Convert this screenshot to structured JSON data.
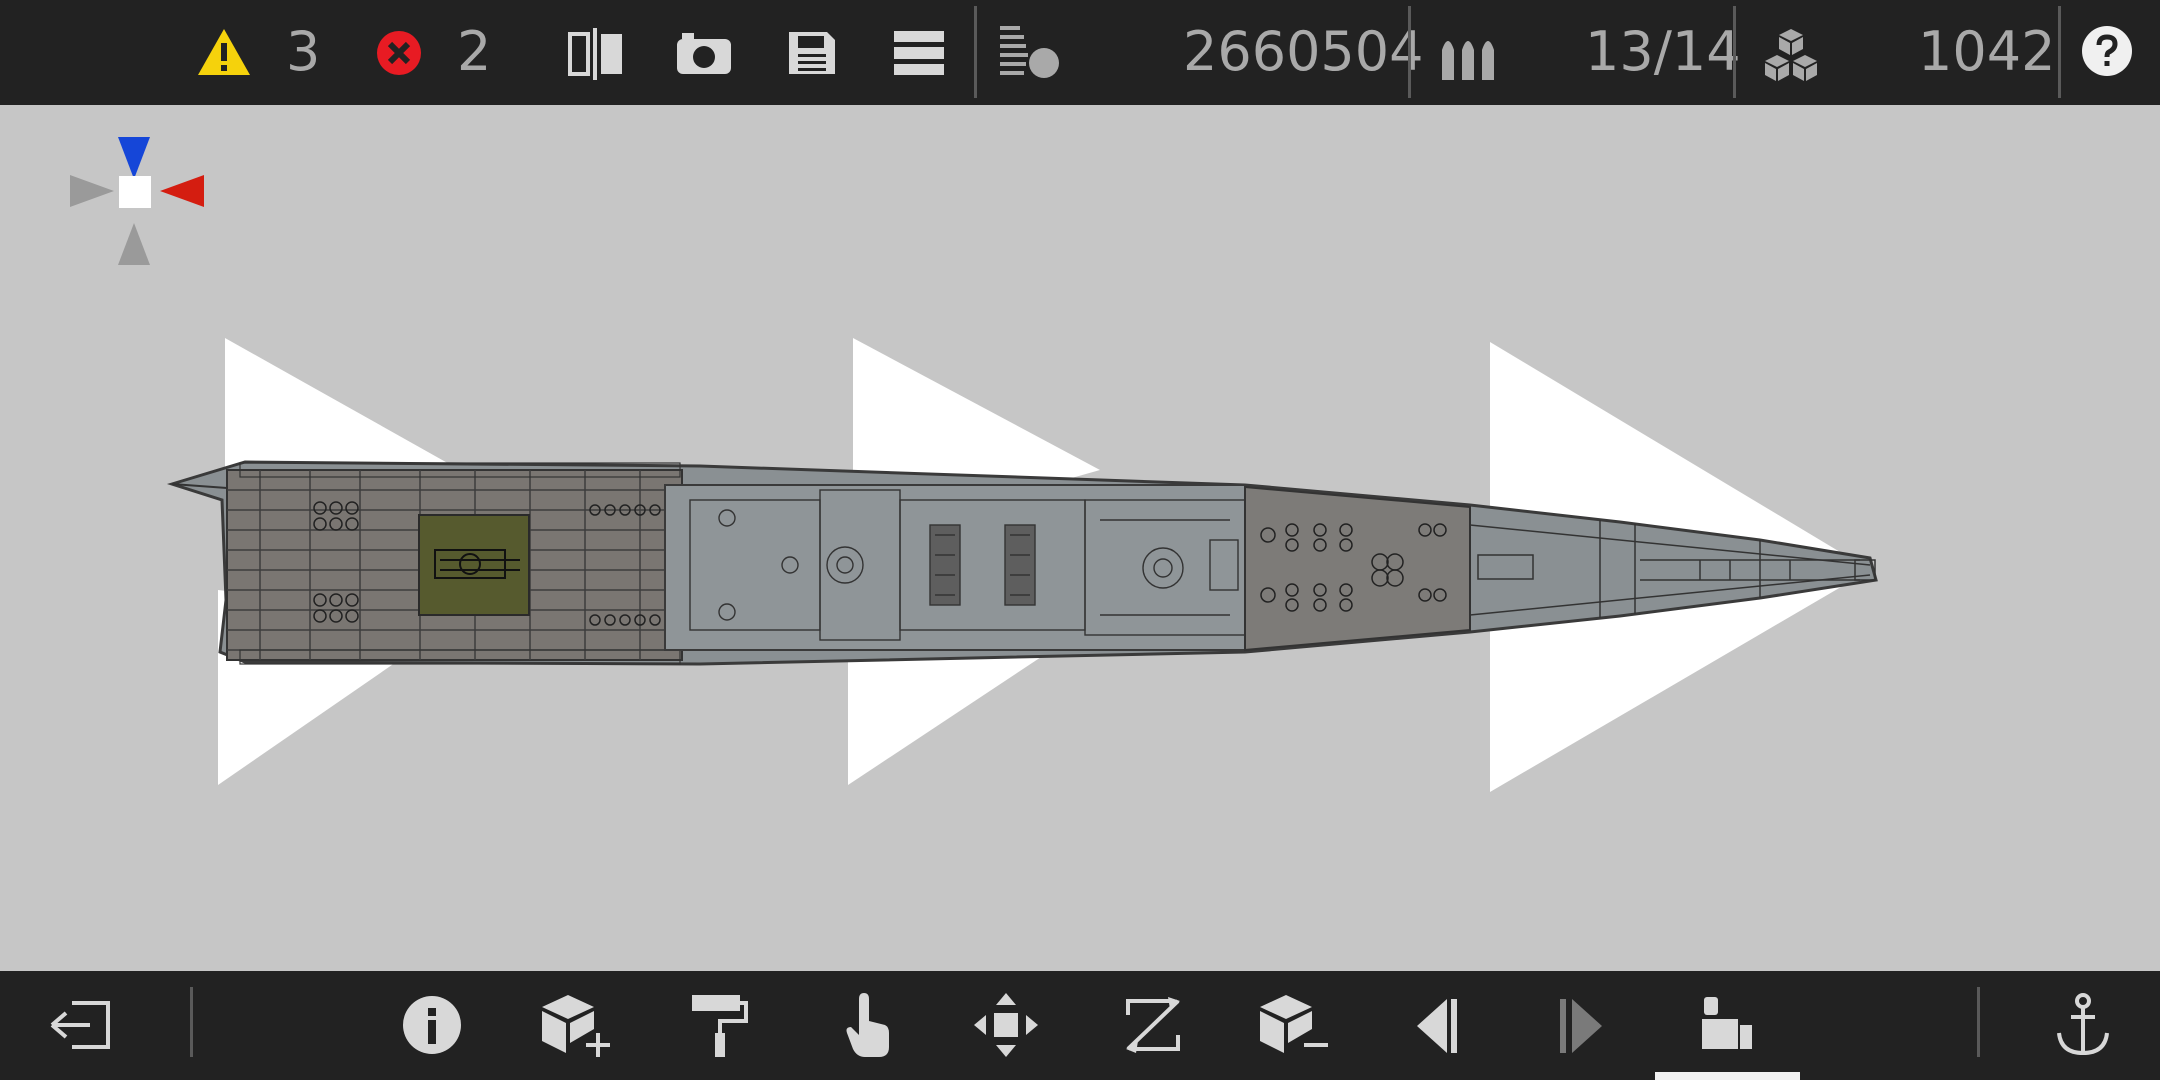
{
  "toolbar": {
    "warnings_count": "3",
    "errors_count": "2",
    "mass_value": "2660504",
    "weapons_value": "13/14",
    "blocks_value": "1042"
  },
  "icons": {
    "warning": "warning-triangle-icon",
    "error": "error-x-icon",
    "mirror": "mirror-split-icon",
    "camera": "camera-icon",
    "save": "save-icon",
    "menu": "menu-icon",
    "stats": "stats-bars-icon",
    "ammo": "ammo-shells-icon",
    "blocks": "blocks-cubes-icon",
    "help": "help-icon",
    "exit": "exit-icon",
    "info": "info-icon",
    "add_block": "add-block-icon",
    "paint": "paint-roller-icon",
    "select": "pointer-hand-icon",
    "move": "move-arrows-icon",
    "rotate": "rotate-frame-icon",
    "remove_block": "remove-block-icon",
    "undo": "undo-icon",
    "redo": "redo-icon",
    "crew": "crew-seat-icon",
    "anchor": "anchor-icon"
  },
  "colors": {
    "warning": "#f5d20c",
    "error": "#e81b23",
    "compass_up": "#1546d8",
    "compass_right": "#d41d10",
    "bar": "#222222",
    "icon": "#d8d8d8"
  }
}
